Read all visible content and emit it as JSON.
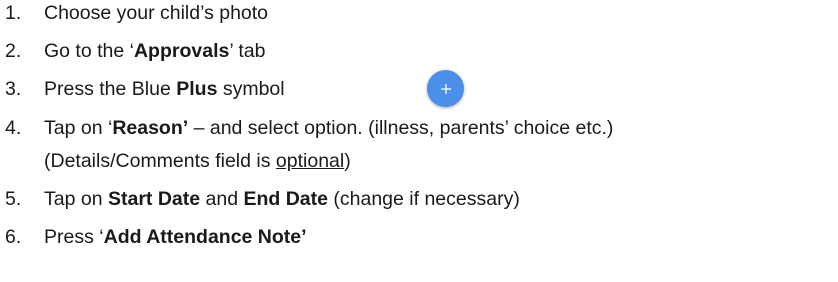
{
  "steps": [
    {
      "number": "1.",
      "text": "Choose your child’s photo"
    },
    {
      "number": "2.",
      "pre": "Go to the ‘",
      "bold": "Approvals",
      "post": "’ tab"
    },
    {
      "number": "3.",
      "pre": "Press the Blue ",
      "bold": "Plus",
      "post": " symbol",
      "icon": "plus-icon",
      "icon_color": "#4a90e8"
    },
    {
      "number": "4.",
      "pre": "Tap on ‘",
      "bold": "Reason’",
      "post": " – and select option. (illness, parents’ choice etc.)",
      "line2_pre": "(Details/Comments field is ",
      "line2_underlined": "optional",
      "line2_post": ")"
    },
    {
      "number": "5.",
      "pre": "Tap on ",
      "bold1": "Start Date",
      "mid": " and ",
      "bold2": "End Date",
      "post": " (change if necessary)"
    },
    {
      "number": "6.",
      "pre": "Press ‘",
      "bold": "Add Attendance Note’"
    }
  ]
}
